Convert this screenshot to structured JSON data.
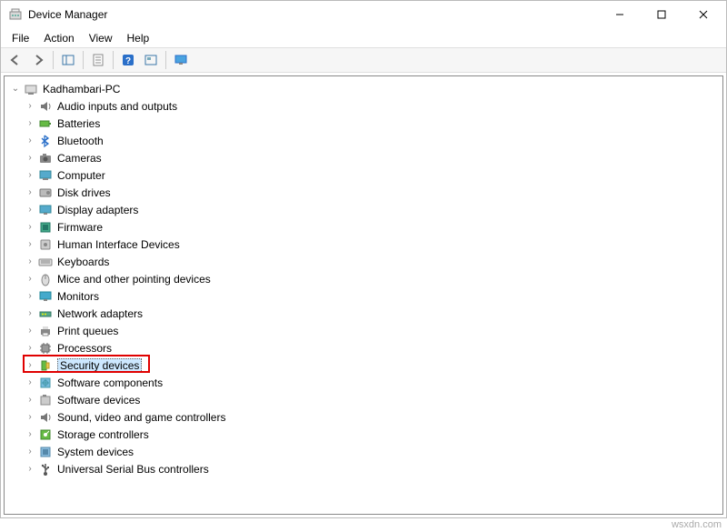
{
  "window": {
    "title": "Device Manager"
  },
  "menubar": {
    "items": [
      "File",
      "Action",
      "View",
      "Help"
    ]
  },
  "tree": {
    "root": "Kadhambari-PC",
    "categories": [
      "Audio inputs and outputs",
      "Batteries",
      "Bluetooth",
      "Cameras",
      "Computer",
      "Disk drives",
      "Display adapters",
      "Firmware",
      "Human Interface Devices",
      "Keyboards",
      "Mice and other pointing devices",
      "Monitors",
      "Network adapters",
      "Print queues",
      "Processors",
      "Security devices",
      "Software components",
      "Software devices",
      "Sound, video and game controllers",
      "Storage controllers",
      "System devices",
      "Universal Serial Bus controllers"
    ],
    "selected_index": 15
  },
  "watermark": "wsxdn.com"
}
